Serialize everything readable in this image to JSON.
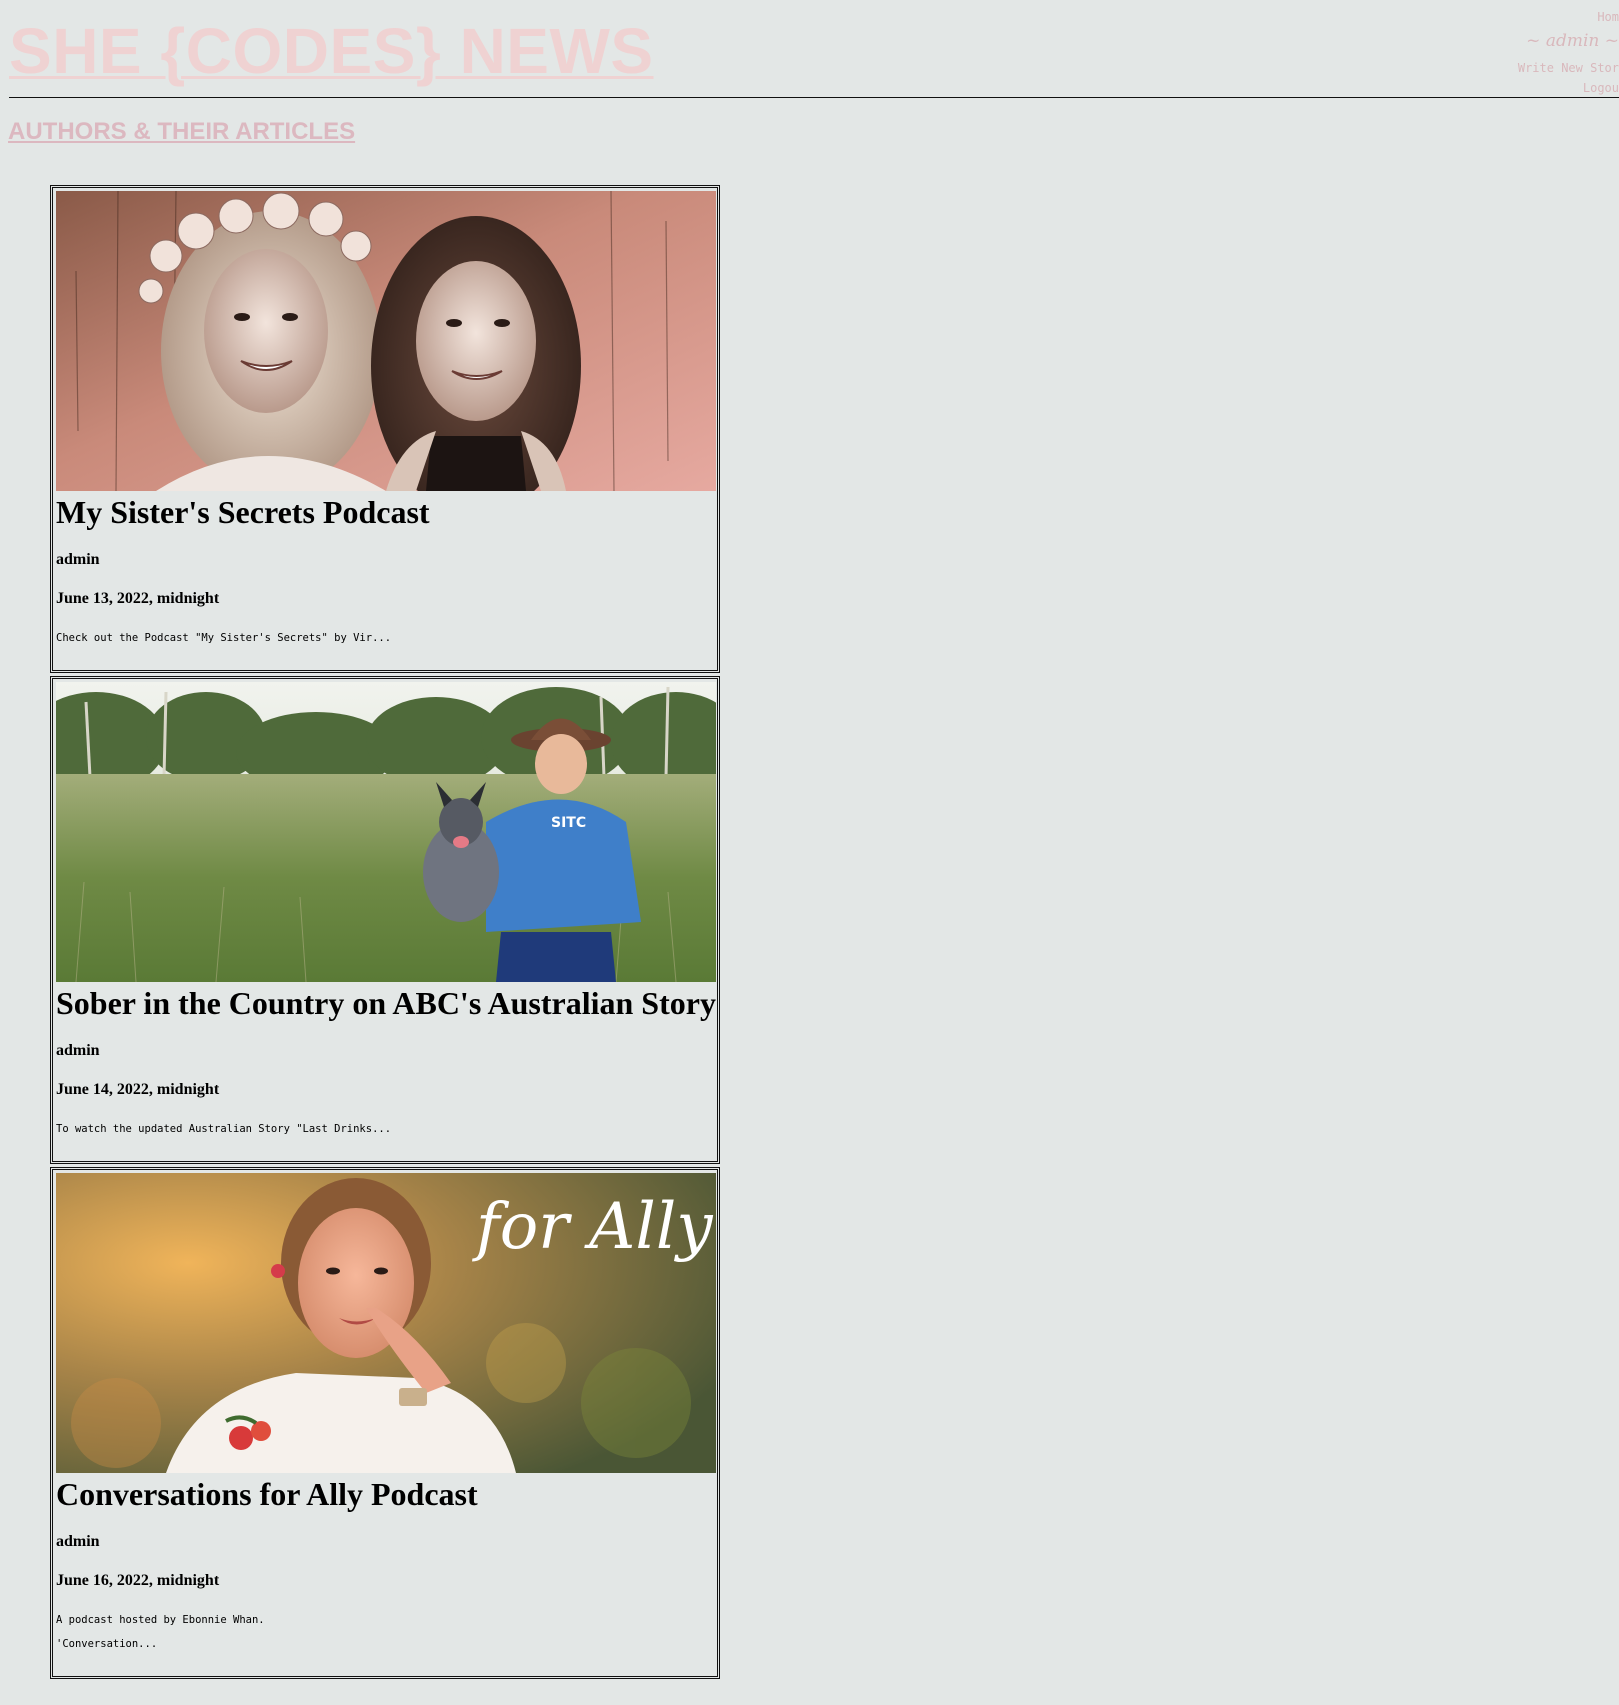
{
  "site": {
    "title": "SHE {CODES} NEWS"
  },
  "nav": {
    "home": "Hom",
    "user": "~ admin ~",
    "write": "Write New Stor",
    "logout": "Logou"
  },
  "section": {
    "heading": "AUTHORS & THEIR ARTICLES"
  },
  "articles": [
    {
      "title": "My Sister's Secrets Podcast",
      "author": "admin",
      "date": "June 13, 2022, midnight",
      "excerpt": "Check out the Podcast \"My Sister's Secrets\" by Vir...",
      "image_icon": "two-women-portrait-image"
    },
    {
      "title": "Sober in the Country on ABC's Australian Story",
      "author": "admin",
      "date": "June 14, 2022, midnight",
      "excerpt": "To watch the updated Australian Story \"Last Drinks...",
      "image_icon": "woman-with-dog-in-field-image",
      "image_text": "SITC"
    },
    {
      "title": "Conversations for Ally Podcast",
      "author": "admin",
      "date": "June 16, 2022, midnight",
      "excerpt": "A podcast hosted by Ebonnie Whan.",
      "excerpt_line2": "'Conversation...",
      "image_icon": "for-ally-portrait-image",
      "image_text": "for Ally"
    }
  ],
  "colors": {
    "background": "#e3e7e6",
    "title_pink": "#efd2d2",
    "nav_pink": "#d9b8bc"
  }
}
